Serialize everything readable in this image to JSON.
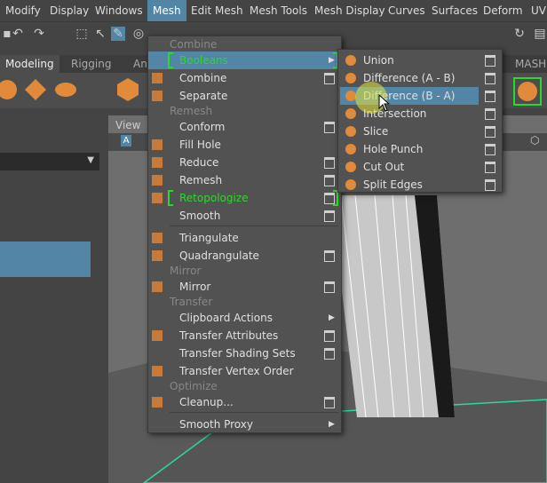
{
  "menubar": [
    "Modify",
    "Display",
    "Windows",
    "Mesh",
    "Edit Mesh",
    "Mesh Tools",
    "Mesh Display",
    "Curves",
    "Surfaces",
    "Deform",
    "UV"
  ],
  "shelf_tabs": [
    "Modeling",
    "Rigging",
    "An"
  ],
  "viewport": {
    "label": "View"
  },
  "right_label": "MASH",
  "mesh_menu": {
    "sections": {
      "combine": "Combine",
      "remesh": "Remesh",
      "mirror": "Mirror",
      "transfer": "Transfer",
      "optimize": "Optimize"
    },
    "items": {
      "booleans": "Booleans",
      "combine": "Combine",
      "separate": "Separate",
      "conform": "Conform",
      "fill_hole": "Fill Hole",
      "reduce": "Reduce",
      "remesh": "Remesh",
      "retopologize": "Retopologize",
      "smooth": "Smooth",
      "triangulate": "Triangulate",
      "quadrangulate": "Quadrangulate",
      "mirror": "Mirror",
      "clipboard_actions": "Clipboard Actions",
      "transfer_attributes": "Transfer Attributes",
      "transfer_shading_sets": "Transfer Shading Sets",
      "transfer_vertex_order": "Transfer Vertex Order",
      "cleanup": "Cleanup...",
      "smooth_proxy": "Smooth Proxy"
    }
  },
  "booleans_menu": {
    "items": {
      "union": "Union",
      "difference_ab": "Difference (A - B)",
      "difference_ba": "Difference (B - A)",
      "intersection": "Intersection",
      "slice": "Slice",
      "hole_punch": "Hole Punch",
      "cut_out": "Cut Out",
      "split_edges": "Split Edges"
    }
  },
  "colors": {
    "highlight": "#5285a6",
    "green": "#2bd82b",
    "menu_bg": "#525252"
  }
}
